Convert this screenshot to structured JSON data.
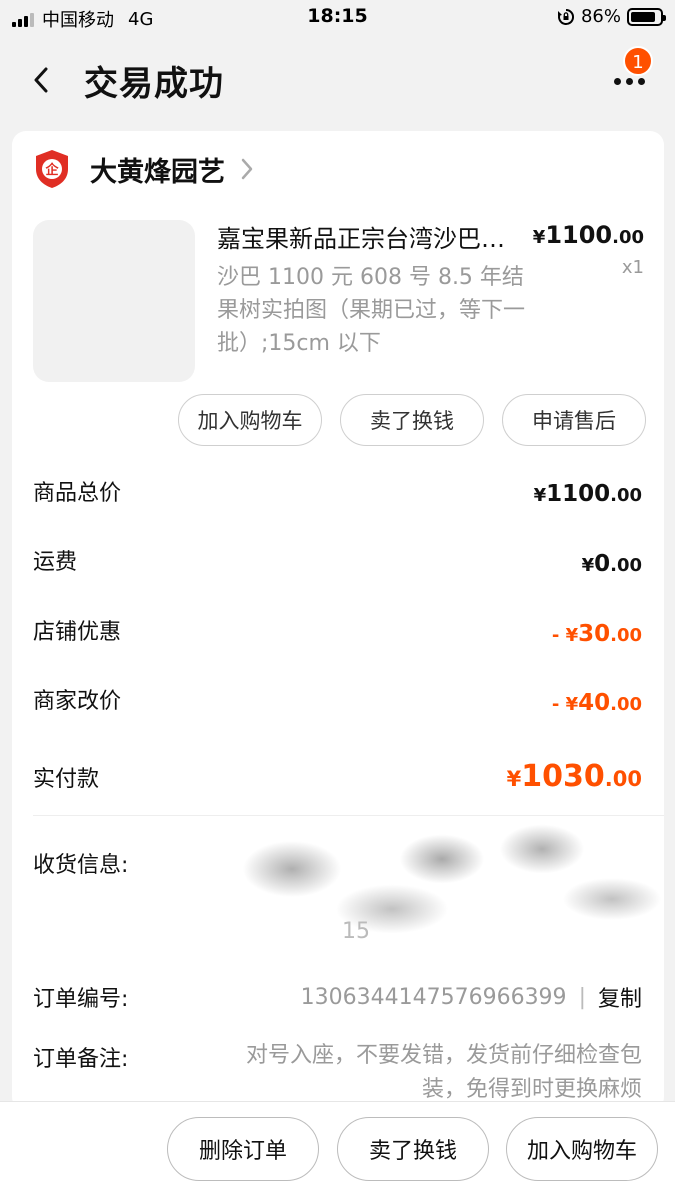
{
  "status_bar": {
    "carrier": "中国移动",
    "network": "4G",
    "time": "18:15",
    "battery": "86%",
    "battery_level": 0.86
  },
  "header": {
    "title": "交易成功",
    "notification_count": "1"
  },
  "shop": {
    "name": "大黄烽园艺",
    "logo_text": "企"
  },
  "product": {
    "title": "嘉宝果新品正宗台湾沙巴…",
    "description": "沙巴 1100 元 608 号 8.5 年结果树实拍图（果期已过，等下一批）;15cm 以下",
    "price_symbol": "¥",
    "price_int": "1100",
    "price_dec": ".00",
    "quantity": "x1"
  },
  "item_actions": {
    "add_to_cart": "加入购物车",
    "sell": "卖了换钱",
    "after_sale": "申请售后"
  },
  "summary": {
    "goods_total_label": "商品总价",
    "goods_total_symbol": "¥",
    "goods_total_int": "1100",
    "goods_total_dec": ".00",
    "shipping_label": "运费",
    "shipping_symbol": "¥",
    "shipping_int": "0",
    "shipping_dec": ".00",
    "shop_discount_label": "店铺优惠",
    "shop_discount_symbol": "- ¥",
    "shop_discount_int": "30",
    "shop_discount_dec": ".00",
    "price_change_label": "商家改价",
    "price_change_symbol": "- ¥",
    "price_change_int": "40",
    "price_change_dec": ".00",
    "paid_label": "实付款",
    "paid_symbol": "¥",
    "paid_int": "1030",
    "paid_dec": ".00"
  },
  "details": {
    "shipping_info_label": "收货信息:",
    "shipping_info_visible_fragment": "15",
    "order_no_label": "订单编号:",
    "order_no": "1306344147576966399",
    "order_no_sep": "|",
    "copy_label": "复制",
    "remark_label": "订单备注:",
    "remark": "对号入座，不要发错，发货前仔细检查包装，免得到时更换麻烦"
  },
  "bottom_bar": {
    "delete_order": "删除订单",
    "sell": "卖了换钱",
    "add_to_cart": "加入购物车"
  },
  "colors": {
    "accent": "#ff5000",
    "shop_logo": "#e02e24"
  }
}
